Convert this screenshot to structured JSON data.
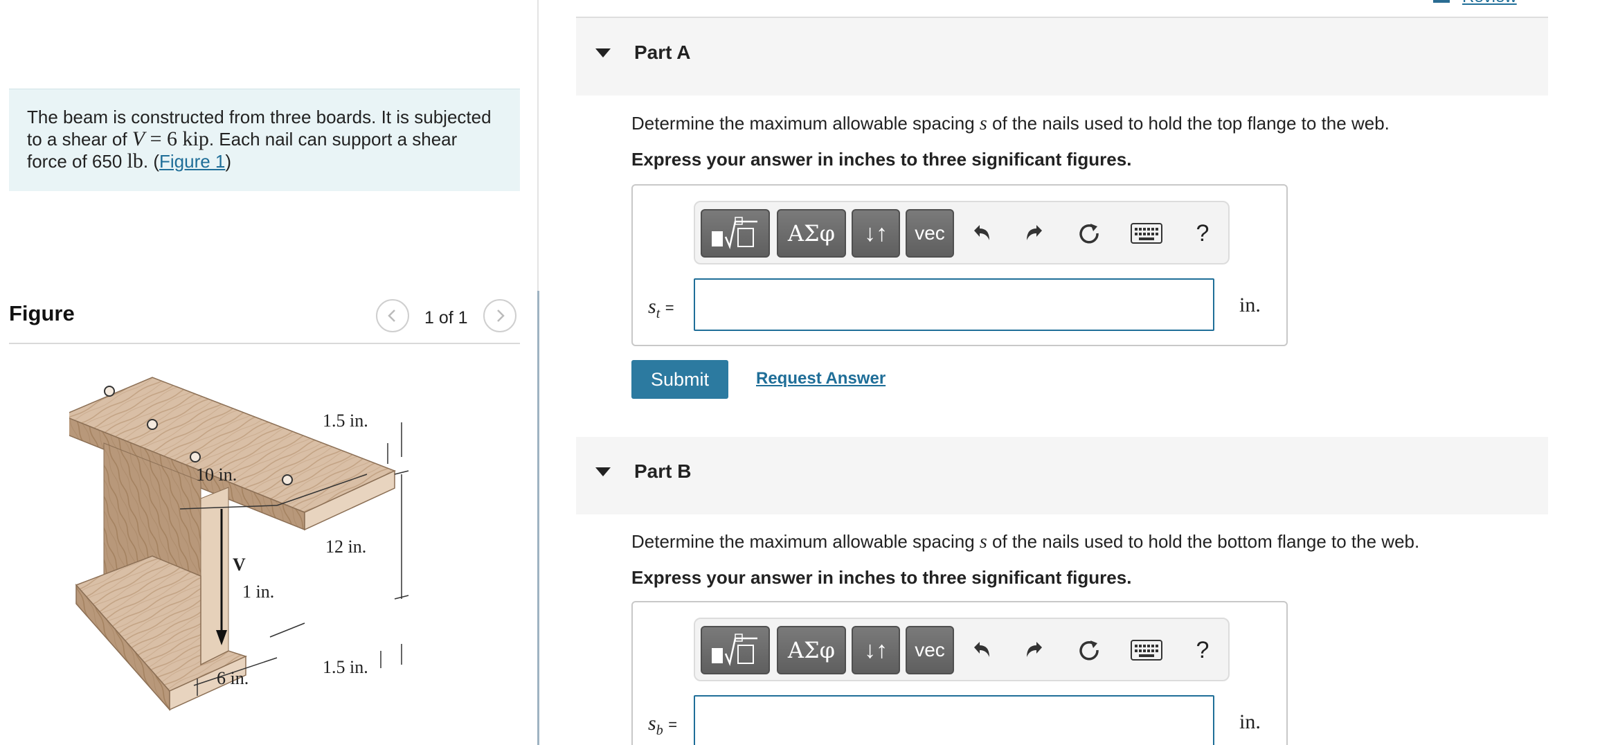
{
  "problem": {
    "text_before": "The beam is constructed from three boards. It is subjected to a shear of ",
    "math_var": "V",
    "math_rest": " = 6 kip",
    "text_mid": ". Each nail can support a shear force of 650 ",
    "math_unit": "lb",
    "text_after_open": ". (",
    "figure_link": "Figure 1",
    "text_close": ")"
  },
  "figure_panel": {
    "title": "Figure",
    "pager": "1 of 1",
    "labels": {
      "top_flange_thickness": "1.5 in.",
      "flange_width_nail": "10 in.",
      "web_height": "12 in.",
      "shear": "V",
      "web_thickness": "1 in.",
      "bottom_flange_thickness": "1.5 in.",
      "bottom_width": "6 in."
    }
  },
  "header": {
    "review_link": "Review"
  },
  "part_a": {
    "title": "Part A",
    "question_before": "Determine the maximum allowable spacing ",
    "question_var": "s",
    "question_after": " of the nails used to hold the top flange to the web.",
    "instruction": "Express your answer in inches to three significant figures.",
    "var_main": "s",
    "var_sub": "t",
    "equals": "=",
    "input_value": "",
    "unit": "in.",
    "submit": "Submit",
    "request_answer": "Request Answer"
  },
  "part_b": {
    "title": "Part B",
    "question_before": "Determine the maximum allowable spacing ",
    "question_var": "s",
    "question_after": " of the nails used to hold the bottom flange to the web.",
    "instruction": "Express your answer in inches to three significant figures.",
    "var_main": "s",
    "var_sub": "b",
    "equals": "=",
    "input_value": "",
    "unit": "in."
  },
  "toolbar": {
    "greek": "ΑΣφ",
    "arrows": "↓↑",
    "vec": "vec",
    "help": "?"
  },
  "colors": {
    "accent": "#2c7aa0",
    "link": "#1f6e98",
    "problem_bg": "#e9f4f6",
    "part_header_bg": "#f5f5f5"
  }
}
